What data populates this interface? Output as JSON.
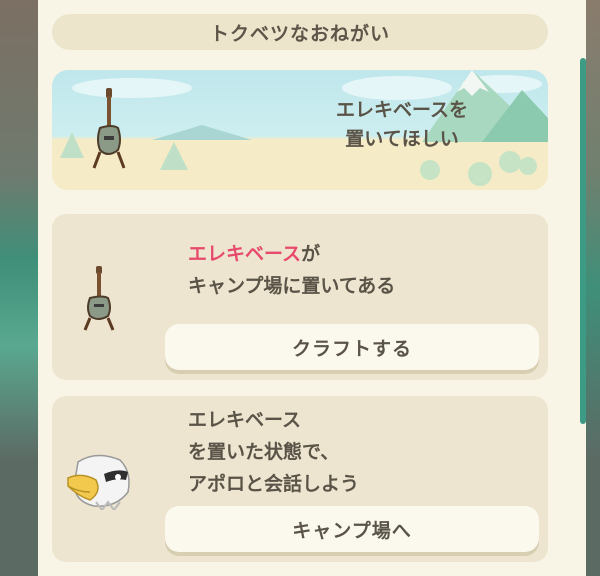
{
  "dialog": {
    "title": "トクベツなおねがい"
  },
  "banner": {
    "line1": "エレキベースを",
    "line2": "置いてほしい",
    "item_icon": "electric-bass-icon"
  },
  "task1": {
    "item_name": "エレキベース",
    "item_suffix": "が",
    "line2": "キャンプ場に置いてある",
    "button_label": "クラフトする",
    "item_icon": "electric-bass-icon",
    "accent_color": "#e74a6d"
  },
  "task2": {
    "line1": "エレキベース",
    "line2": "を置いた状態で、",
    "line3": "アポロと会話しよう",
    "button_label": "キャンプ場へ",
    "character_icon": "apollo-eagle-icon"
  }
}
